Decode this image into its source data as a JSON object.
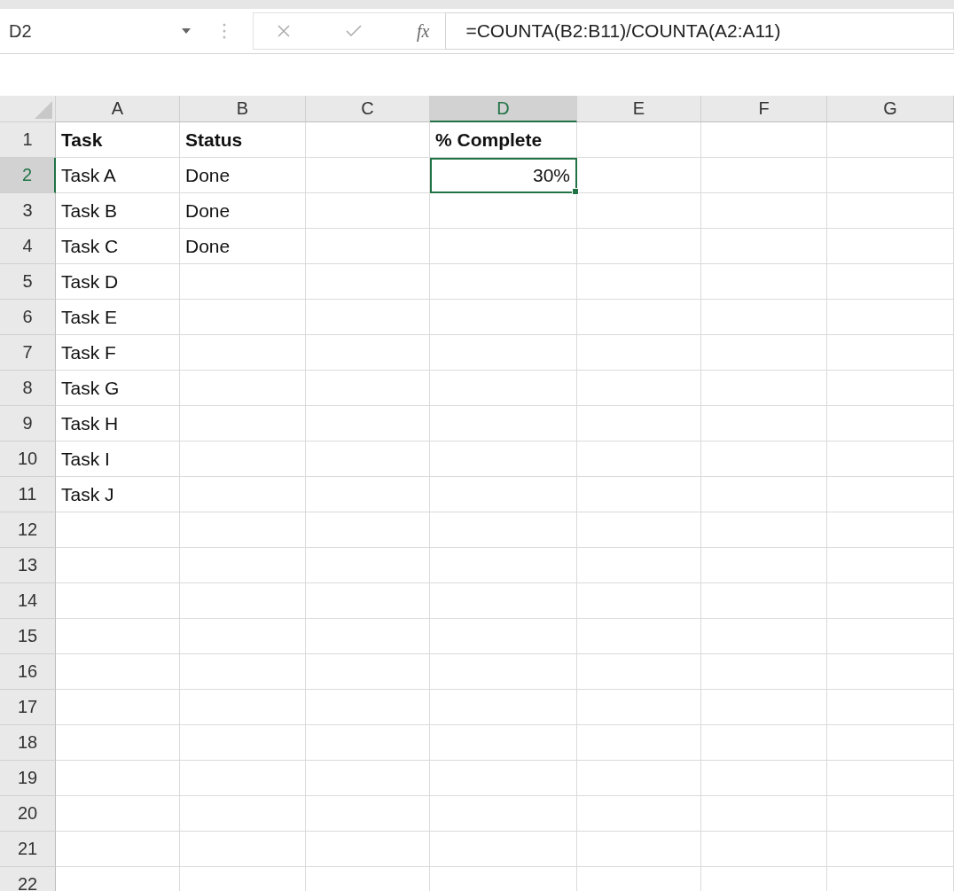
{
  "name_box": {
    "value": "D2"
  },
  "formula_bar": {
    "fx": "fx",
    "formula": "=COUNTA(B2:B11)/COUNTA(A2:A11)"
  },
  "columns": [
    {
      "label": "A",
      "selected": false
    },
    {
      "label": "B",
      "selected": false
    },
    {
      "label": "C",
      "selected": false
    },
    {
      "label": "D",
      "selected": true
    },
    {
      "label": "E",
      "selected": false
    },
    {
      "label": "F",
      "selected": false
    },
    {
      "label": "G",
      "selected": false
    }
  ],
  "rows": [
    {
      "number": "1",
      "selected": false,
      "cells": {
        "A": {
          "text": "Task",
          "kind": "header",
          "selected": false
        },
        "B": {
          "text": "Status",
          "kind": "header",
          "selected": false
        },
        "D": {
          "text": "% Complete",
          "kind": "header",
          "selected": false
        }
      }
    },
    {
      "number": "2",
      "selected": true,
      "cells": {
        "A": {
          "text": "Task A",
          "kind": "text",
          "selected": false
        },
        "B": {
          "text": "Done",
          "kind": "text",
          "selected": false
        },
        "D": {
          "text": "30%",
          "kind": "number",
          "selected": true
        }
      }
    },
    {
      "number": "3",
      "selected": false,
      "cells": {
        "A": {
          "text": "Task B",
          "kind": "text",
          "selected": false
        },
        "B": {
          "text": "Done",
          "kind": "text",
          "selected": false
        }
      }
    },
    {
      "number": "4",
      "selected": false,
      "cells": {
        "A": {
          "text": "Task C",
          "kind": "text",
          "selected": false
        },
        "B": {
          "text": "Done",
          "kind": "text",
          "selected": false
        }
      }
    },
    {
      "number": "5",
      "selected": false,
      "cells": {
        "A": {
          "text": "Task D",
          "kind": "text",
          "selected": false
        }
      }
    },
    {
      "number": "6",
      "selected": false,
      "cells": {
        "A": {
          "text": "Task E",
          "kind": "text",
          "selected": false
        }
      }
    },
    {
      "number": "7",
      "selected": false,
      "cells": {
        "A": {
          "text": "Task F",
          "kind": "text",
          "selected": false
        }
      }
    },
    {
      "number": "8",
      "selected": false,
      "cells": {
        "A": {
          "text": "Task G",
          "kind": "text",
          "selected": false
        }
      }
    },
    {
      "number": "9",
      "selected": false,
      "cells": {
        "A": {
          "text": "Task H",
          "kind": "text",
          "selected": false
        }
      }
    },
    {
      "number": "10",
      "selected": false,
      "cells": {
        "A": {
          "text": "Task I",
          "kind": "text",
          "selected": false
        }
      }
    },
    {
      "number": "11",
      "selected": false,
      "cells": {
        "A": {
          "text": "Task J",
          "kind": "text",
          "selected": false
        }
      }
    },
    {
      "number": "12",
      "selected": false
    },
    {
      "number": "13",
      "selected": false
    },
    {
      "number": "14",
      "selected": false
    },
    {
      "number": "15",
      "selected": false
    },
    {
      "number": "16",
      "selected": false
    },
    {
      "number": "17",
      "selected": false
    },
    {
      "number": "18",
      "selected": false
    },
    {
      "number": "19",
      "selected": false
    },
    {
      "number": "20",
      "selected": false
    },
    {
      "number": "21",
      "selected": false
    },
    {
      "number": "22",
      "selected": false
    }
  ]
}
